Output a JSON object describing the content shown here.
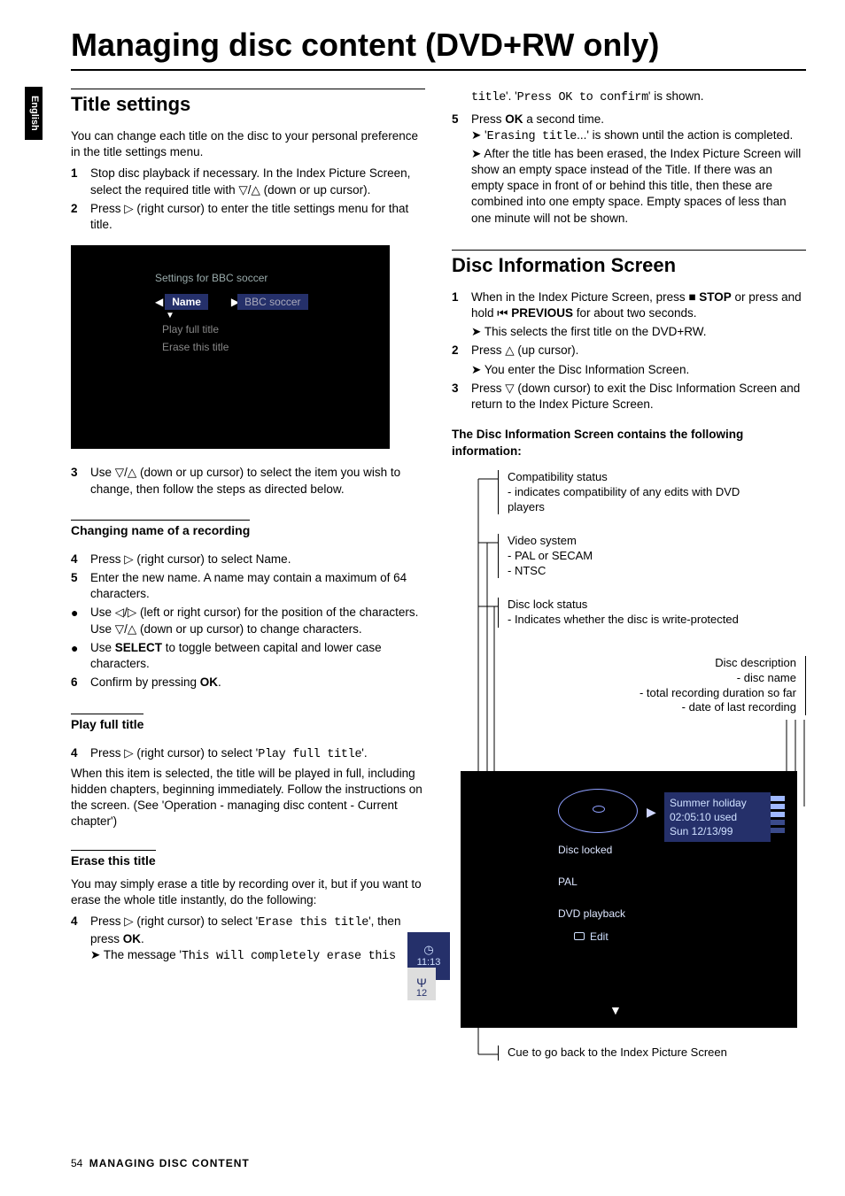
{
  "meta": {
    "language_tab": "English",
    "page_title": "Managing disc content (DVD+RW only)",
    "footer_page": "54",
    "footer_title": "MANAGING DISC CONTENT"
  },
  "left": {
    "sec1_title": "Title settings",
    "sec1_intro": "You can change each title on the disc to your personal preference in the title settings menu.",
    "sec1_steps": [
      {
        "n": "1",
        "t": "Stop disc playback if necessary. In the Index Picture Screen, select the required title with ▽/△ (down or up cursor)."
      },
      {
        "n": "2",
        "t": "Press ▷ (right cursor) to enter the title settings menu for that title."
      }
    ],
    "ui": {
      "header": "Settings for BBC soccer",
      "row_sel": "Name",
      "row_val": "BBC soccer",
      "row2": "Play full title",
      "row3": "Erase this title"
    },
    "sec1_step3": {
      "n": "3",
      "t": "Use ▽/△ (down or up cursor) to select the item you wish to change, then follow the steps as directed below."
    },
    "sub_change": "Changing name of a recording",
    "change_steps": [
      {
        "n": "4",
        "t": "Press ▷ (right cursor) to select Name."
      },
      {
        "n": "5",
        "t": "Enter the new name. A name may contain a maximum of 64 characters."
      },
      {
        "n": "●",
        "t": "Use ◁/▷ (left or right cursor) for the position of the characters. Use ▽/△ (down or up cursor) to change characters."
      },
      {
        "n": "●",
        "t_pre": "Use ",
        "t_bold": "SELECT",
        "t_post": " to toggle between capital and lower case characters."
      },
      {
        "n": "6",
        "t_pre": "Confirm by pressing ",
        "t_bold": "OK",
        "t_post": "."
      }
    ],
    "sub_play": "Play full title",
    "play_step4_pre": "Press ▷ (right cursor) to select '",
    "play_step4_os": "Play full title",
    "play_step4_post": "'.",
    "play_body": "When this item is selected, the title will be played in full, including hidden chapters, beginning immediately. Follow the instructions on the screen. (See 'Operation - managing disc content - Current chapter')",
    "sub_erase": "Erase this title",
    "erase_intro": "You may simply erase a title by recording over it, but if you want to erase the whole title instantly, do the following:",
    "erase_step4_pre": "Press ▷ (right cursor) to select '",
    "erase_step4_os": "Erase this title",
    "erase_step4_mid": "', then press ",
    "erase_step4_bold": "OK",
    "erase_step4_post": ".",
    "erase_msg_pre": "➤ The message '",
    "erase_msg_os": "This will completely erase this"
  },
  "right": {
    "cont_line1_os": "title",
    "cont_line1_mid": "'. '",
    "cont_line1_os2": "Press OK to confirm",
    "cont_line1_post": "' is shown.",
    "step5_pre": "Press ",
    "step5_bold": "OK",
    "step5_post": " a second time.",
    "step5_arrow_pre": "➤ '",
    "step5_arrow_os": "Erasing title",
    "step5_arrow_post": "...' is shown until the action is completed.",
    "step5_after": "➤ After the title has been erased, the Index Picture Screen will show an empty space instead of the Title. If there was an empty space in front of or behind this title, then these are combined into one empty space. Empty spaces of less than one minute will not be shown.",
    "sec2_title": "Disc Information Screen",
    "disc_steps": [
      {
        "n": "1",
        "t_pre": "When in the Index Picture Screen, press ■ ",
        "t_b1": "STOP",
        "t_mid": " or press and hold ⏮ ",
        "t_b2": "PREVIOUS",
        "t_post": " for about two seconds."
      },
      {
        "n": "",
        "t": "➤ This selects the first title on the DVD+RW."
      },
      {
        "n": "2",
        "t": "Press △ (up cursor)."
      },
      {
        "n": "",
        "t": "➤ You enter the Disc Information Screen."
      },
      {
        "n": "3",
        "t": "Press ▽ (down cursor) to exit the Disc Information Screen and return to the Index Picture Screen."
      }
    ],
    "disc_subhead": "The Disc Information Screen contains the following information:",
    "callouts": {
      "c1a": "Compatibility status",
      "c1b": "- indicates compatibility of any edits with DVD players",
      "c2a": "Video system",
      "c2b": "- PAL or SECAM",
      "c2c": "- NTSC",
      "c3a": "Disc lock status",
      "c3b": "- Indicates whether the disc is write-protected",
      "c4a": "Disc description",
      "c4b": "- disc name",
      "c4c": "- total recording duration so far",
      "c4d": "- date of last recording",
      "c5": "Cue to go back to the Index Picture Screen"
    },
    "disc_ui": {
      "desc1": "Summer holiday",
      "desc2": "02:05:10 used",
      "desc3": "Sun 12/13/99",
      "lock": "Disc locked",
      "pal": "PAL",
      "play": "DVD playback",
      "edit": "Edit",
      "time": "11:13 pm",
      "tuner": "12"
    }
  }
}
